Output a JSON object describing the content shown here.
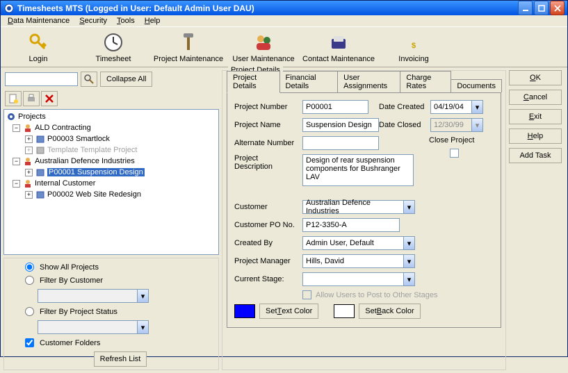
{
  "window": {
    "title": "Timesheets MTS (Logged in User: Default Admin User DAU)"
  },
  "menu": {
    "data": "Data Maintenance",
    "security": "Security",
    "tools": "Tools",
    "help": "Help"
  },
  "toolbar": {
    "login": "Login",
    "timesheet": "Timesheet",
    "project": "Project Maintenance",
    "user": "User Maintenance",
    "contact": "Contact Maintenance",
    "invoicing": "Invoicing"
  },
  "left": {
    "collapse": "Collapse All",
    "tree": {
      "root": "Projects",
      "n1": "ALD Contracting",
      "n1a": "P00003 Smartlock",
      "n1b": "Template Template Project",
      "n2": "Australian Defence Industries",
      "n2a": "P00001 Suspension Design",
      "n3": "Internal Customer",
      "n3a": "P00002 Web Site Redesign"
    },
    "filters": {
      "showAll": "Show All Projects",
      "byCustomer": "Filter By Customer",
      "byStatus": "Filter By Project Status",
      "folders": "Customer Folders",
      "refresh": "Refresh List"
    }
  },
  "details": {
    "groupTitle": "Project Details",
    "tabs": {
      "project": "Project Details",
      "financial": "Financial Details",
      "users": "User Assignments",
      "rates": "Charge Rates",
      "docs": "Documents"
    },
    "labels": {
      "number": "Project Number",
      "name": "Project Name",
      "alt": "Alternate Number",
      "desc": "Project Description",
      "customer": "Customer",
      "po": "Customer PO No.",
      "createdBy": "Created By",
      "pm": "Project Manager",
      "stage": "Current Stage:",
      "dateCreated": "Date Created",
      "dateClosed": "Date Closed",
      "closeProject": "Close Project",
      "allowPost": "Allow Users to Post to Other Stages",
      "setText": "Set Text Color",
      "setBack": "Set Back Color"
    },
    "values": {
      "number": "P00001",
      "name": "Suspension Design",
      "alt": "",
      "desc": "Design of rear suspension components for Bushranger LAV",
      "customer": "Australian Defence Industries",
      "po": "P12-3350-A",
      "createdBy": "Admin User, Default",
      "pm": "Hills, David",
      "stage": "",
      "dateCreated": "04/19/04",
      "dateClosed": "12/30/99",
      "textColor": "#0000ff",
      "backColor": "#ffffff"
    }
  },
  "buttons": {
    "ok": "OK",
    "cancel": "Cancel",
    "exit": "Exit",
    "help": "Help",
    "addTask": "Add Task"
  }
}
